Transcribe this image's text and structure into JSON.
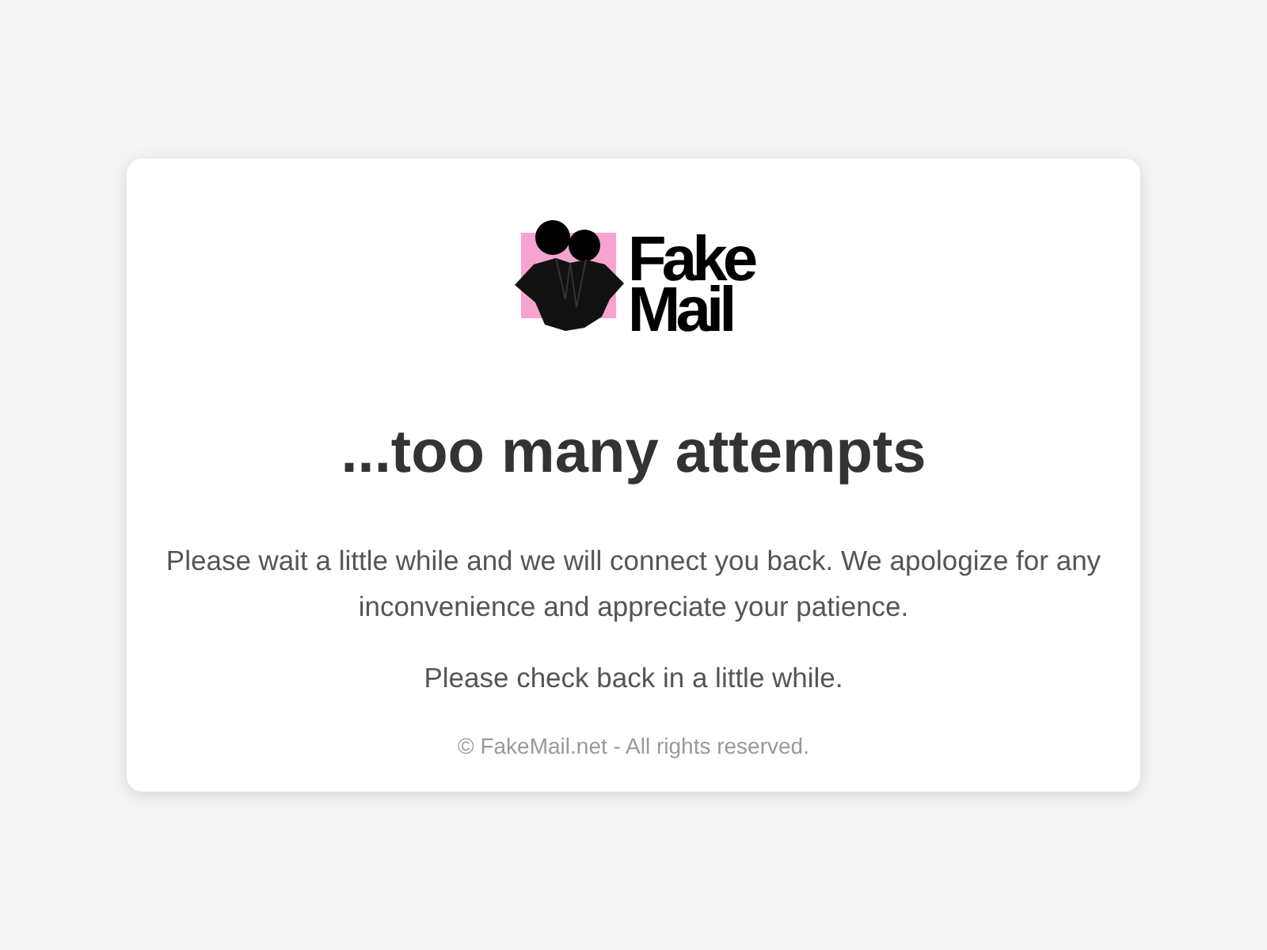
{
  "logo": {
    "lines": [
      "Fake",
      "Mail"
    ]
  },
  "heading": "...too many attempts",
  "paragraphs": [
    "Please wait a little while and we will connect you back. We apologize for any inconvenience and appreciate your patience.",
    "Please check back in a little while."
  ],
  "footer": "© FakeMail.net - All rights reserved."
}
